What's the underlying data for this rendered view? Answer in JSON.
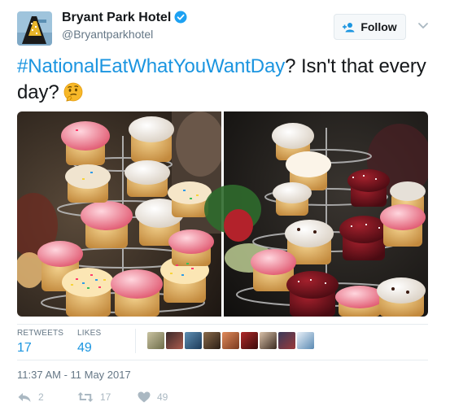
{
  "user": {
    "name": "Bryant Park Hotel",
    "handle": "@Bryantparkhotel",
    "verified": true
  },
  "follow_button": {
    "label": "Follow",
    "icon": "add-user-icon"
  },
  "tweet": {
    "hashtag": "#NationalEatWhatYouWantDay",
    "text": "? Isn't that every day?",
    "emoji": "thinking-face"
  },
  "media": {
    "description_icon": "photo",
    "count": 2
  },
  "stats": {
    "retweets_label": "RETWEETS",
    "retweets": "17",
    "likes_label": "LIKES",
    "likes": "49",
    "likers_count": 9
  },
  "timestamp": "11:37 AM - 11 May 2017",
  "actions": {
    "reply": "2",
    "retweet": "17",
    "like": "49"
  },
  "colors": {
    "accent": "#1b95e0",
    "text": "#14171a",
    "secondary": "#657786",
    "action_gray": "#aab8c2",
    "divider": "#e6ecf0"
  }
}
